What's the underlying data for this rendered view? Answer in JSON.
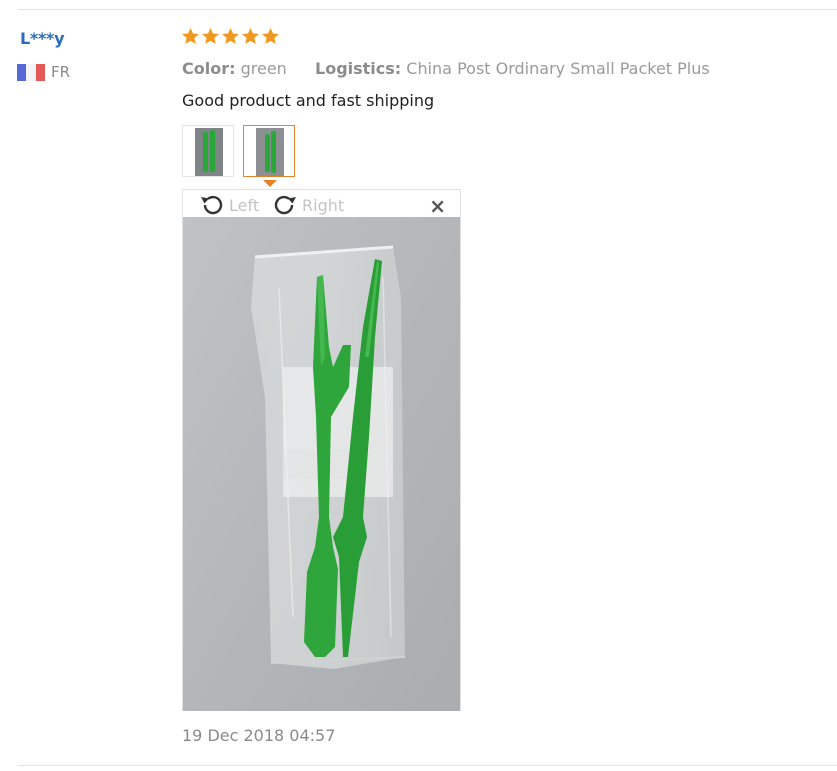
{
  "review": {
    "user": "L***y",
    "country": "FR",
    "rating": 5,
    "color_label": "Color:",
    "color_value": "green",
    "logistics_label": "Logistics:",
    "logistics_value": "China Post Ordinary Small Packet Plus",
    "text": "Good product and fast shipping",
    "date": "19 Dec 2018 04:57"
  },
  "viewer": {
    "rotate_left": "Left",
    "rotate_right": "Right",
    "close": "×",
    "active_thumbnail": 2
  },
  "colors": {
    "username": "#2a6ebb",
    "star": "#f0991e",
    "active_border": "#e2822a",
    "tool_green": "#29a83a"
  }
}
